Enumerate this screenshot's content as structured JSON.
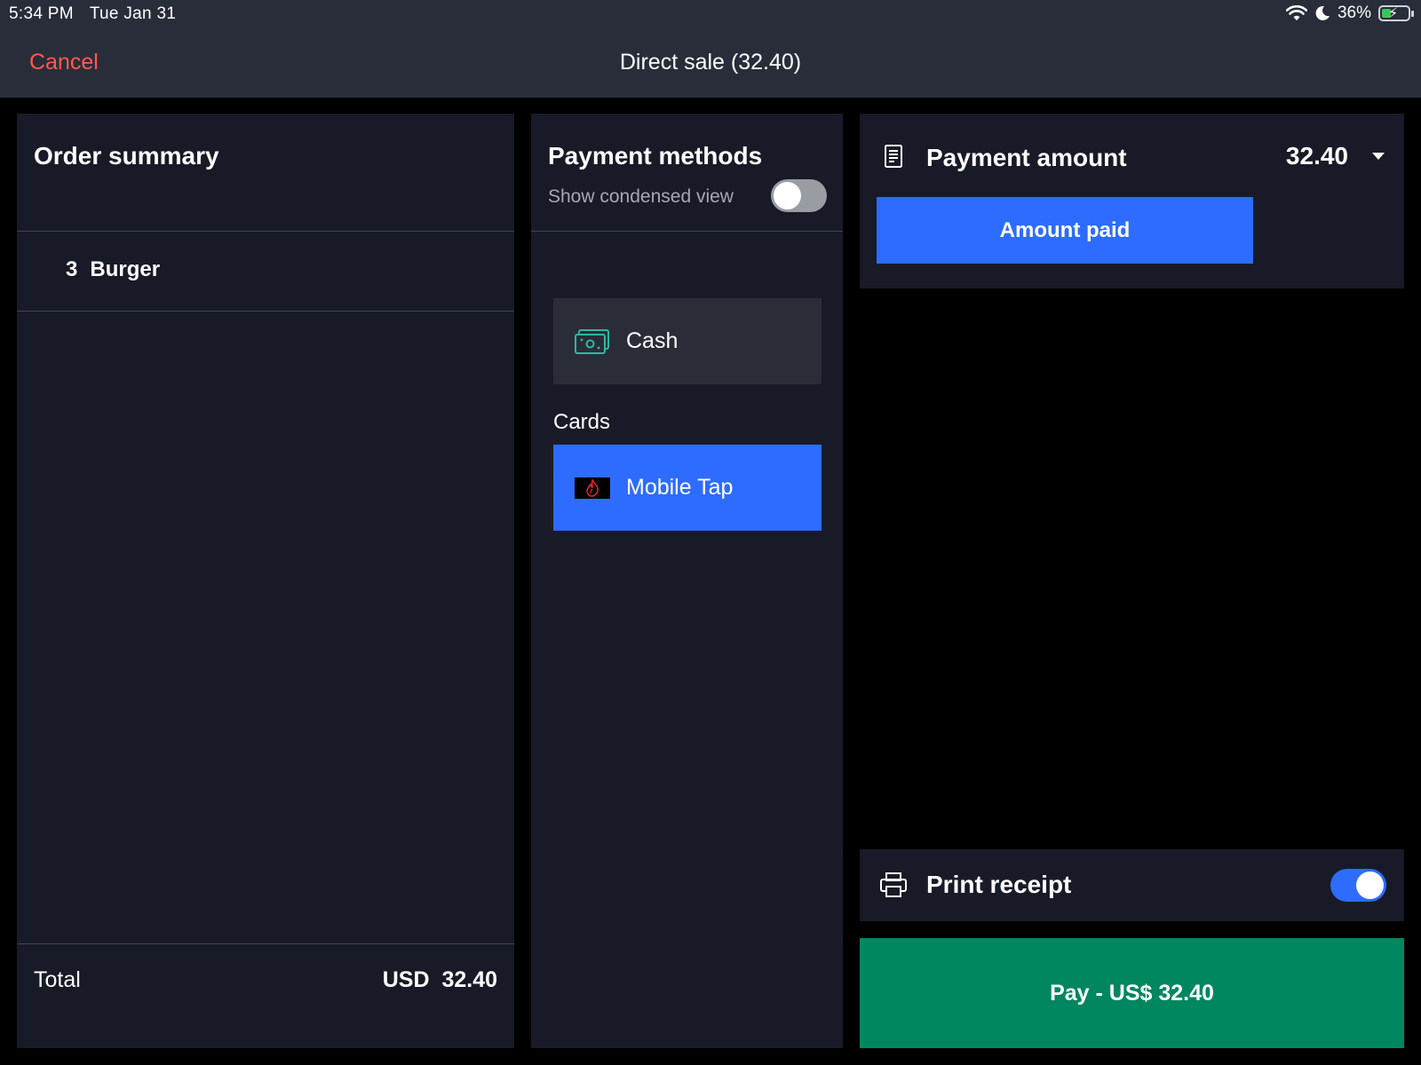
{
  "status_bar": {
    "time": "5:34 PM",
    "date": "Tue Jan 31",
    "battery": "36%",
    "battery_level": 0.36
  },
  "nav": {
    "cancel_label": "Cancel",
    "title": "Direct sale (32.40)"
  },
  "order_summary": {
    "title": "Order summary",
    "items": [
      {
        "qty": "3",
        "name": "Burger"
      }
    ],
    "total_label": "Total",
    "total_currency": "USD",
    "total_value": "32.40"
  },
  "payment_methods": {
    "title": "Payment methods",
    "condensed_label": "Show condensed view",
    "condensed_on": false,
    "cash_label": "Cash",
    "cards_label": "Cards",
    "mobile_tap_label": "Mobile Tap"
  },
  "payment_amount": {
    "title": "Payment amount",
    "value": "32.40",
    "amount_paid_label": "Amount paid"
  },
  "print_receipt": {
    "label": "Print receipt",
    "on": true
  },
  "pay_button": {
    "label": "Pay - US$ 32.40"
  },
  "colors": {
    "accent_blue": "#2d6cff",
    "pay_green": "#00875f",
    "cancel_red": "#ff5a4e",
    "cash_icon": "#2fb8a0"
  }
}
